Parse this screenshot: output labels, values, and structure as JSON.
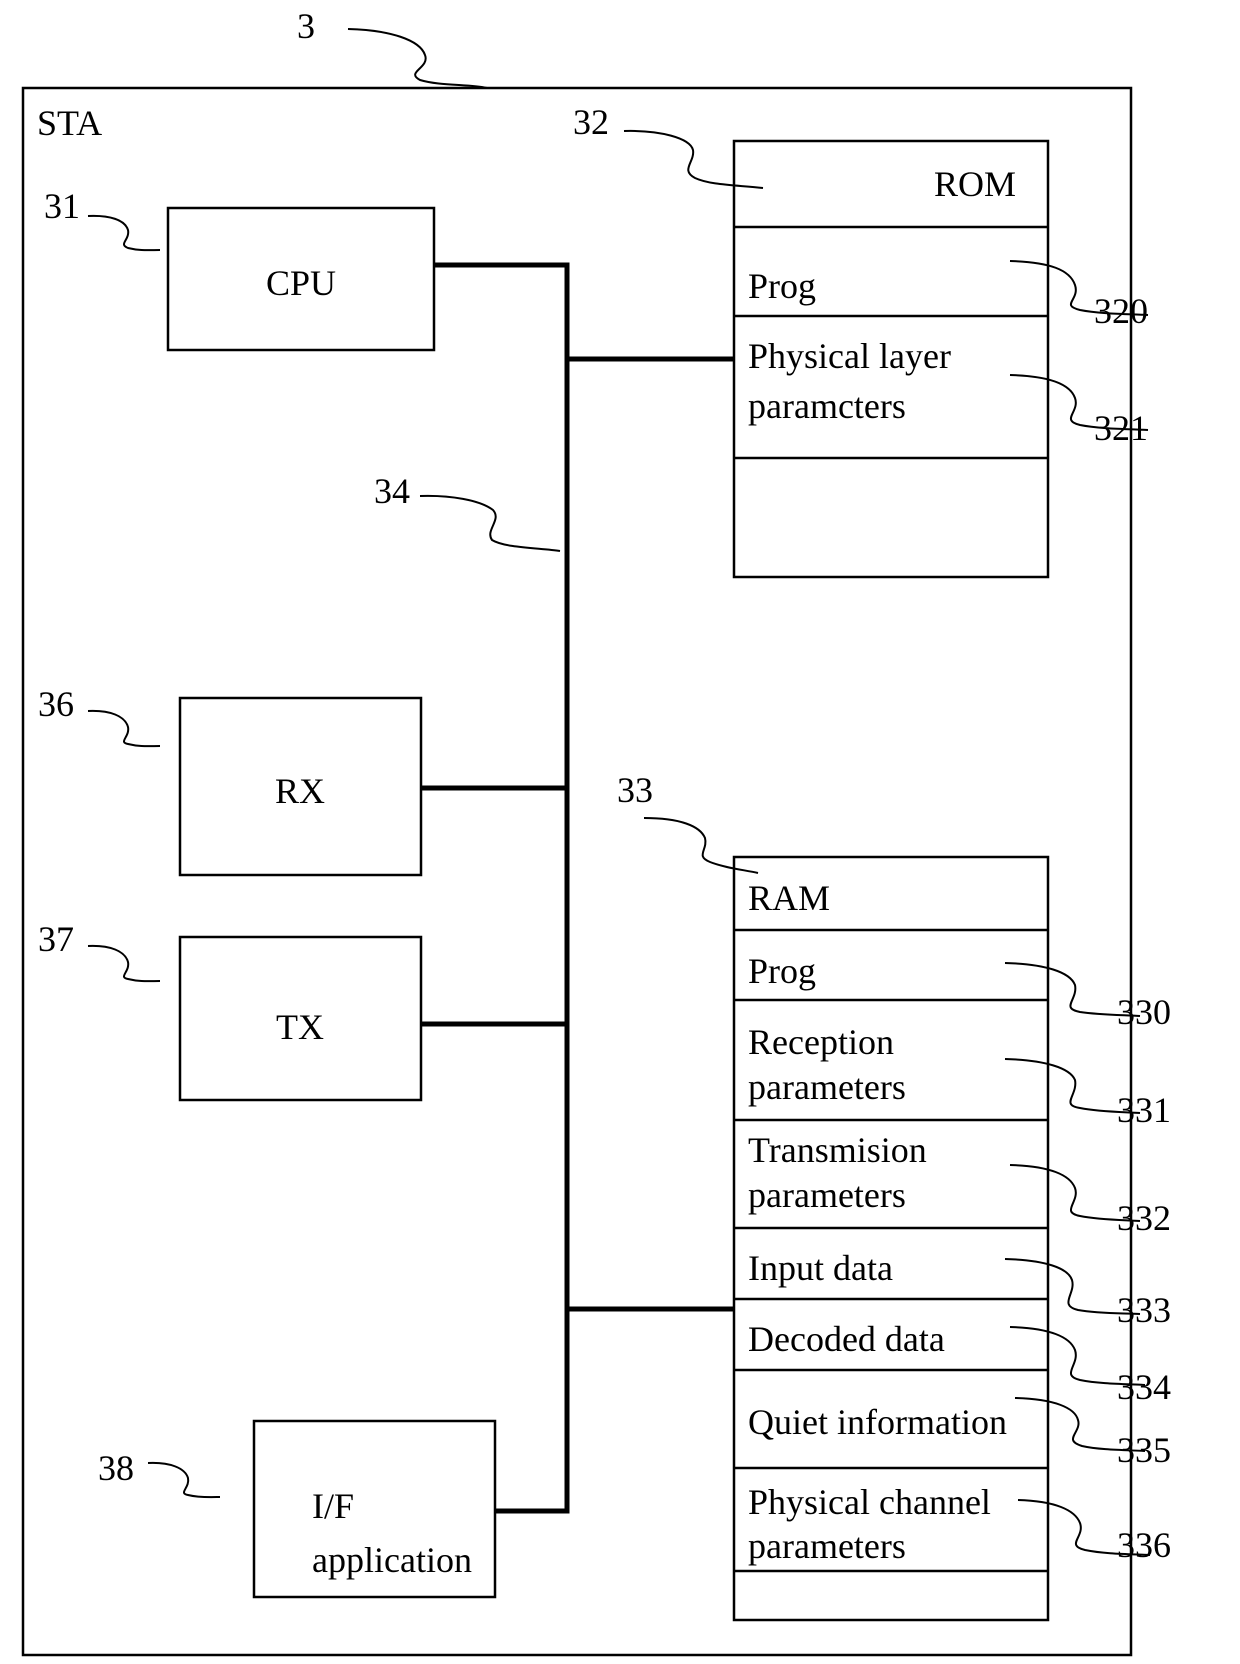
{
  "figure": {
    "ref": "3",
    "container_label": "STA",
    "bus_ref": "34"
  },
  "blocks": {
    "cpu": {
      "ref": "31",
      "label": "CPU"
    },
    "rx": {
      "ref": "36",
      "label": "RX"
    },
    "tx": {
      "ref": "37",
      "label": "TX"
    },
    "iface": {
      "ref": "38",
      "label_line1": "I/F",
      "label_line2": "application"
    }
  },
  "rom": {
    "ref": "32",
    "title": "ROM",
    "rows": [
      {
        "ref": "320",
        "line1": "Prog",
        "line2": ""
      },
      {
        "ref": "321",
        "line1": "Physical layer",
        "line2": "paramcters"
      }
    ]
  },
  "ram": {
    "ref": "33",
    "title": "RAM",
    "rows": [
      {
        "ref": "330",
        "line1": "Prog",
        "line2": ""
      },
      {
        "ref": "331",
        "line1": "Reception",
        "line2": "parameters"
      },
      {
        "ref": "332",
        "line1": "Transmision",
        "line2": "parameters"
      },
      {
        "ref": "333",
        "line1": "Input data",
        "line2": ""
      },
      {
        "ref": "334",
        "line1": "Decoded data",
        "line2": ""
      },
      {
        "ref": "335",
        "line1": "Quiet information",
        "line2": ""
      },
      {
        "ref": "336",
        "line1": "Physical channel",
        "line2": "parameters"
      }
    ]
  }
}
